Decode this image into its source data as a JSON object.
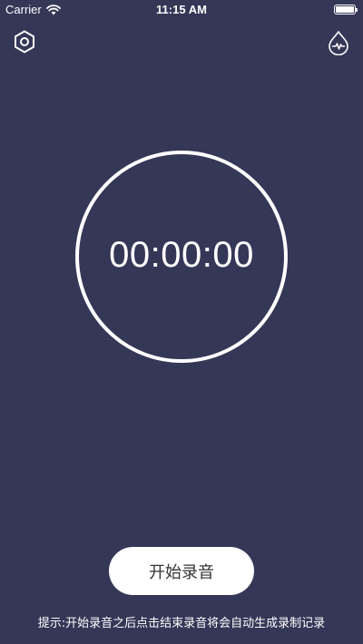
{
  "status_bar": {
    "carrier": "Carrier",
    "time": "11:15 AM"
  },
  "toolbar": {
    "left_icon": "settings-hexagon-icon",
    "right_icon": "activity-drop-icon"
  },
  "timer": {
    "display": "00:00:00"
  },
  "actions": {
    "start_label": "开始录音"
  },
  "hint": {
    "text": "提示:开始录音之后点击结束录音将会自动生成录制记录"
  },
  "colors": {
    "background": "#353757",
    "foreground": "#ffffff",
    "button_text": "#333333"
  }
}
